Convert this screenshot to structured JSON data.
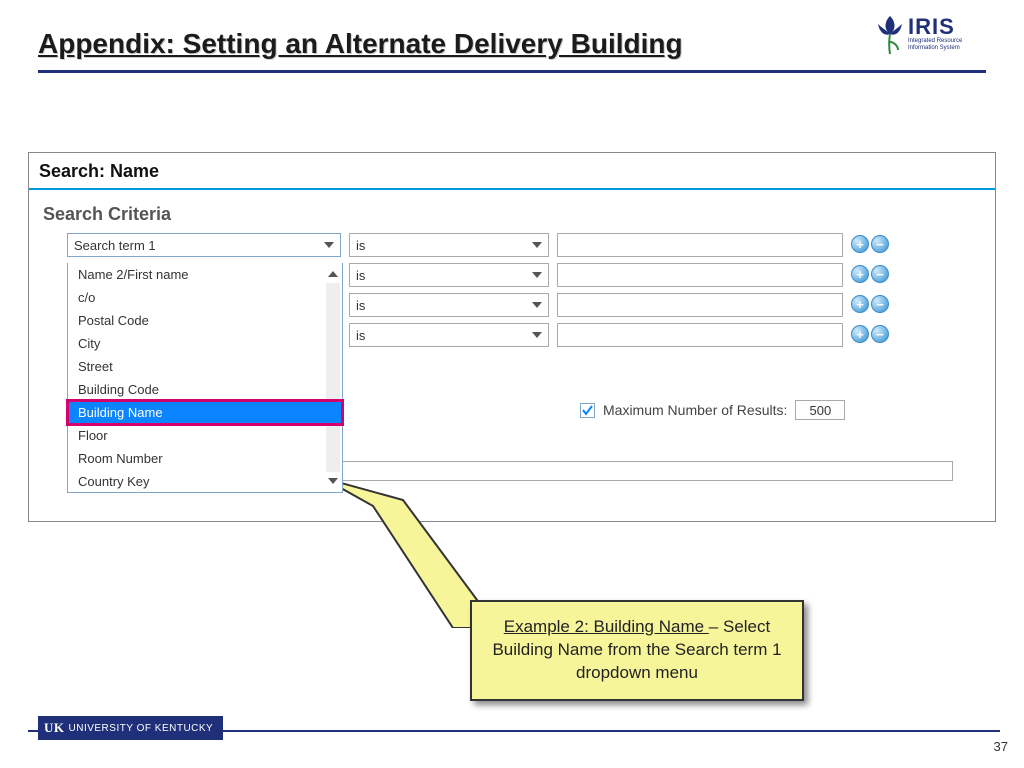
{
  "header": {
    "title": "Appendix: Setting an Alternate Delivery Building",
    "logo_name": "IRIS",
    "logo_sub1": "Integrated Resource",
    "logo_sub2": "Information System"
  },
  "panel": {
    "search_header": "Search: Name",
    "criteria_title": "Search Criteria",
    "field_select_value": "Search term 1",
    "rows": [
      {
        "operator": "is"
      },
      {
        "operator": "is"
      },
      {
        "operator": "is"
      },
      {
        "operator": "is"
      }
    ],
    "dropdown_items": [
      "Name 2/First name",
      "c/o",
      "Postal Code",
      "City",
      "Street",
      "Building Code",
      "Building Name",
      "Floor",
      "Room Number",
      "Country Key"
    ],
    "highlight_index": 6,
    "max_results_label": "Maximum Number of Results:",
    "max_results_value": "500"
  },
  "callout": {
    "lead": "Example 2: Building Name ",
    "rest": "– Select Building Name from the Search term 1 dropdown menu"
  },
  "footer": {
    "uk_initials": "UK",
    "uk_text": "UNIVERSITY OF KENTUCKY",
    "page": "37"
  }
}
